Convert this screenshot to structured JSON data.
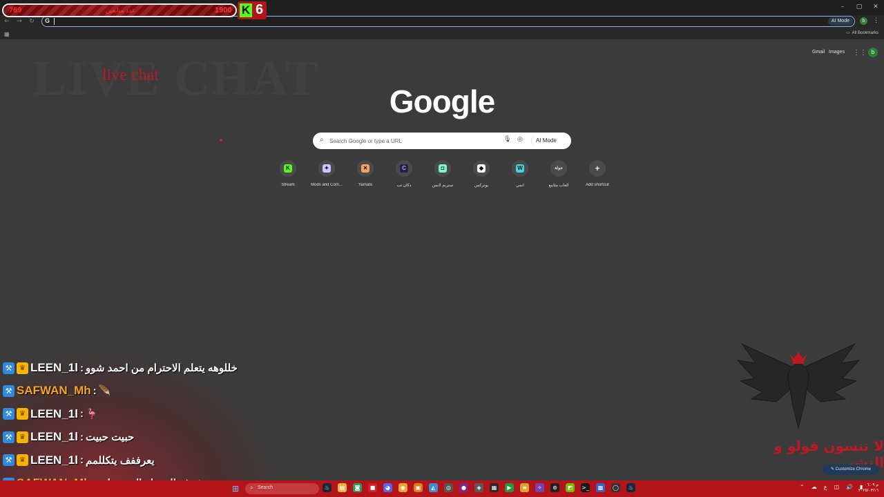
{
  "overlay": {
    "score_left": "769",
    "score_label": "عدد متابعين",
    "score_right": "1900",
    "kick_logo": "K",
    "kick_number": "6",
    "live_chat_watermark": "LIVE CHAT",
    "live_chat_script": "live chat",
    "follow_message": "لا تنسون فولو و النشر"
  },
  "browser": {
    "omnibox_icon": "G",
    "omnibox_value": "",
    "ai_mode_label": "AI Mode",
    "profile_initial": "b",
    "all_bookmarks_label": "All Bookmarks",
    "window_controls": [
      "–",
      "▢",
      "✕"
    ]
  },
  "ntp": {
    "gmail_label": "Gmail",
    "images_label": "Images",
    "avatar_initial": "b",
    "logo_text": "Google",
    "search_placeholder": "Search Google or type a URL",
    "ai_mode_label": "AI Mode",
    "customize_label": "Customize Chrome",
    "shortcuts": [
      {
        "label": "Stream",
        "icon": "K",
        "icon_name": "kick-icon",
        "color": "#53fc18"
      },
      {
        "label": "Mods and Com...",
        "icon": "✦",
        "icon_name": "mods-icon",
        "color": "#c7c9ff"
      },
      {
        "label": "Yamato",
        "icon": "✕",
        "icon_name": "yamato-icon",
        "color": "#f4a46b"
      },
      {
        "label": "دكان تب",
        "icon": "C",
        "icon_name": "dukkan-icon",
        "color": "#2a1f4a"
      },
      {
        "label": "ستريم لابس",
        "icon": "◘",
        "icon_name": "streamlabs-icon",
        "color": "#80f5d2"
      },
      {
        "label": "يوتركس",
        "icon": "◆",
        "icon_name": "diamond-icon",
        "color": "#ffffff"
      },
      {
        "label": "انمي",
        "icon": "W",
        "icon_name": "anime-icon",
        "color": "#3ad8e0"
      },
      {
        "label": "العاب مثابيع",
        "icon": "جولة",
        "icon_name": "games-icon",
        "color": "#4a4a4a"
      },
      {
        "label": "Add shortcut",
        "icon": "+",
        "icon_name": "plus-icon",
        "color": "#4a4a4a"
      }
    ]
  },
  "chat": {
    "messages": [
      {
        "user": "LEEN_1l",
        "sep": " : ",
        "text": "خللوهه يتعلم الاحترام من احمد شوو",
        "user_color": "#ffffff",
        "badges": [
          "sword",
          "crown"
        ],
        "emote": ""
      },
      {
        "user": "SAFWAN_Mh",
        "sep": " : ",
        "text": "",
        "user_color": "#f5a623",
        "badges": [
          "sword"
        ],
        "emote": "🪶"
      },
      {
        "user": "LEEN_1l",
        "sep": " : ",
        "text": "",
        "user_color": "#ffffff",
        "badges": [
          "sword",
          "crown"
        ],
        "emote": "🦩"
      },
      {
        "user": "LEEN_1l",
        "sep": " : ",
        "text": "حبيت حبيت",
        "user_color": "#ffffff",
        "badges": [
          "sword",
          "crown"
        ],
        "emote": ""
      },
      {
        "user": "LEEN_1l",
        "sep": " : ",
        "text": "يعرففف يتكللمم",
        "user_color": "#ffffff",
        "badges": [
          "sword",
          "crown"
        ],
        "emote": ""
      },
      {
        "user": "SAFWAN_Mh",
        "sep": " : ",
        "text": "شوف المقطع الي رسلته",
        "user_color": "#f5a623",
        "badges": [
          "sword"
        ],
        "emote": ""
      }
    ]
  },
  "taskbar": {
    "search_label": "Search",
    "start_icon": "⊞",
    "apps": [
      {
        "name": "steam-icon",
        "glyph": "♨",
        "color": "#1b2838"
      },
      {
        "name": "file-explorer-icon",
        "glyph": "▤",
        "color": "#e8b44a"
      },
      {
        "name": "green-app-icon",
        "glyph": "◙",
        "color": "#2e9d5a"
      },
      {
        "name": "red-app-icon",
        "glyph": "■",
        "color": "#d4202a"
      },
      {
        "name": "discord-icon",
        "glyph": "◕",
        "color": "#5865f2"
      },
      {
        "name": "chrome-icon",
        "glyph": "◉",
        "color": "#e6a52e"
      },
      {
        "name": "orange-app-icon",
        "glyph": "▣",
        "color": "#e07a1f"
      },
      {
        "name": "photos-icon",
        "glyph": "◭",
        "color": "#3b8fd6"
      },
      {
        "name": "circle-app-icon",
        "glyph": "◎",
        "color": "#555555"
      },
      {
        "name": "mic-app-icon",
        "glyph": "●",
        "color": "#7a2a8a"
      },
      {
        "name": "network-app-icon",
        "glyph": "◈",
        "color": "#5a5a5a"
      },
      {
        "name": "sheet-app-icon",
        "glyph": "▦",
        "color": "#2a2a2a"
      },
      {
        "name": "green-play-icon",
        "glyph": "▶",
        "color": "#1e9b3b"
      },
      {
        "name": "yellow-app-icon",
        "glyph": "≡",
        "color": "#d8a531"
      },
      {
        "name": "purple-app-icon",
        "glyph": "✧",
        "color": "#7a3fb0"
      },
      {
        "name": "obs-icon",
        "glyph": "⊛",
        "color": "#202020"
      },
      {
        "name": "nvidia-icon",
        "glyph": "◩",
        "color": "#76b900"
      },
      {
        "name": "terminal-icon",
        "glyph": ">_",
        "color": "#1a1a1a"
      },
      {
        "name": "blue-app-icon",
        "glyph": "▩",
        "color": "#3a62c8"
      },
      {
        "name": "github-icon",
        "glyph": "◯",
        "color": "#333333"
      },
      {
        "name": "steam-alt-icon",
        "glyph": "♨",
        "color": "#1b2838"
      }
    ],
    "tray_icons": [
      "⌃",
      "☁",
      "ع",
      "◫",
      "🔊",
      "▮"
    ],
    "clock_time": "م ٠٦:٠٩",
    "clock_date": "٢٠٢٥/٠٣/١٦"
  }
}
